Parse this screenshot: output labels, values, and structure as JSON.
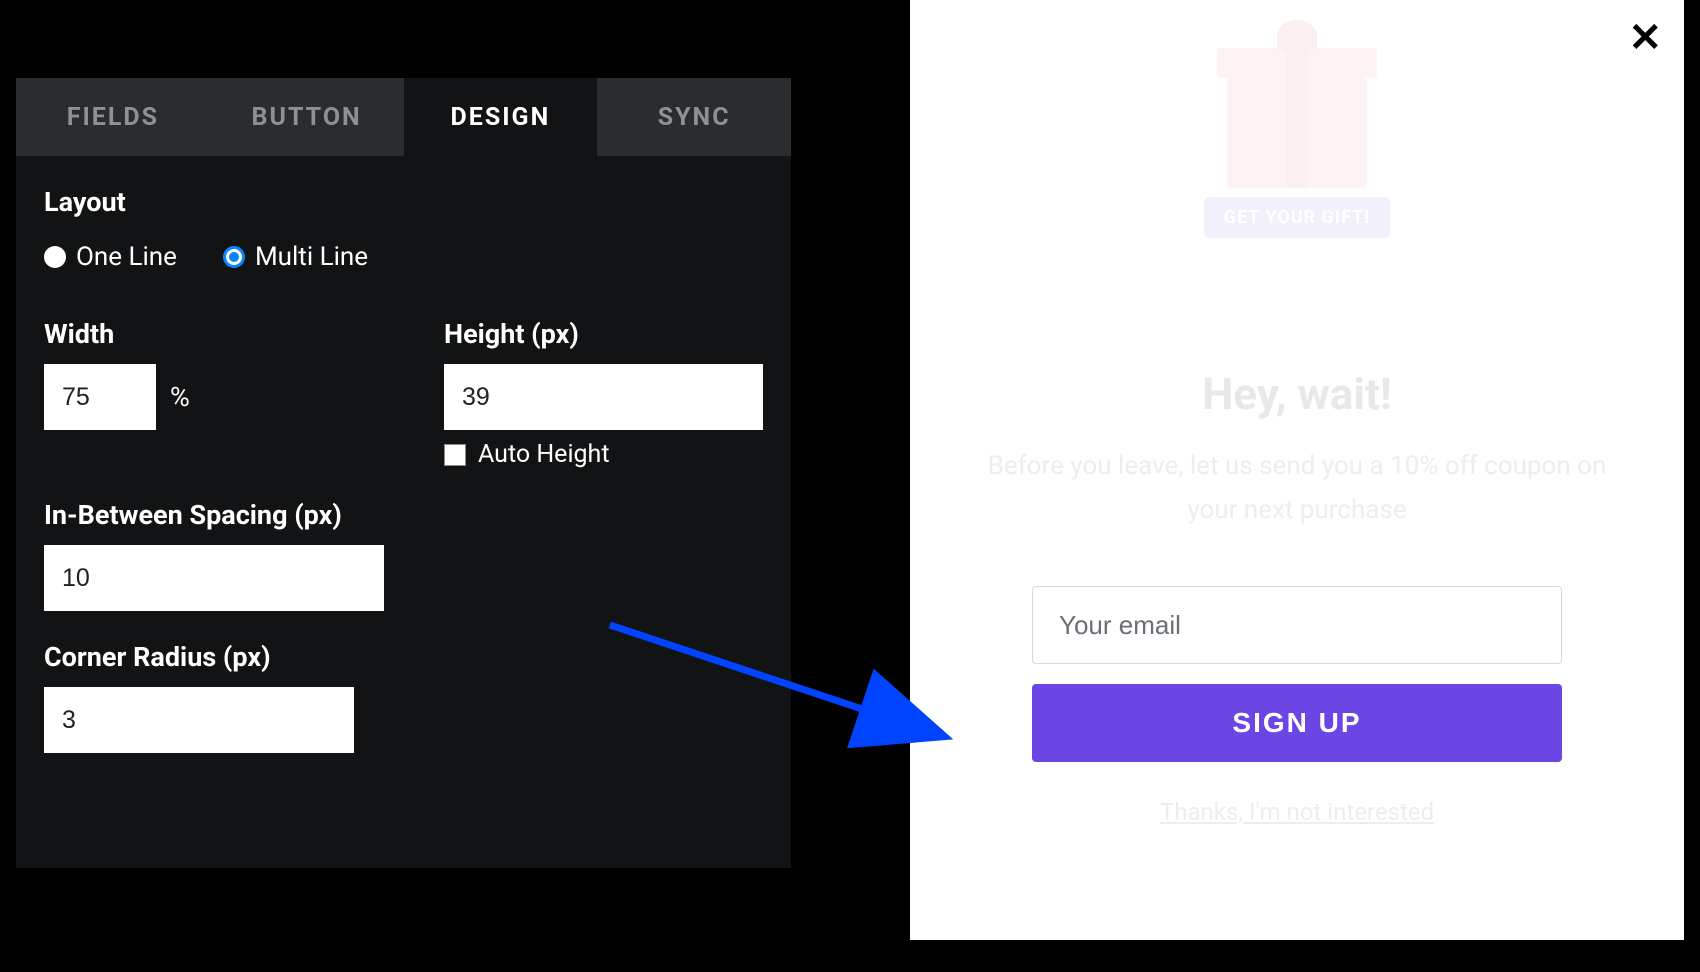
{
  "tabs": {
    "fields": "FIELDS",
    "button": "BUTTON",
    "design": "DESIGN",
    "sync": "SYNC"
  },
  "design": {
    "layout_title": "Layout",
    "layout_one_line": "One Line",
    "layout_multi_line": "Multi Line",
    "layout_selected": "multi",
    "width_label": "Width",
    "width_value": "75",
    "width_unit": "%",
    "height_label": "Height (px)",
    "height_value": "39",
    "auto_height_label": "Auto Height",
    "auto_height_checked": false,
    "spacing_label": "In-Between Spacing (px)",
    "spacing_value": "10",
    "radius_label": "Corner Radius (px)",
    "radius_value": "3"
  },
  "popup": {
    "gift_badge": "GET YOUR GIFT!",
    "title": "Hey, wait!",
    "subtitle": "Before you leave, let us send you a 10% off coupon on your next purchase",
    "email_placeholder": "Your email",
    "button_label": "SIGN UP",
    "dismiss": "Thanks, I'm not interested"
  }
}
